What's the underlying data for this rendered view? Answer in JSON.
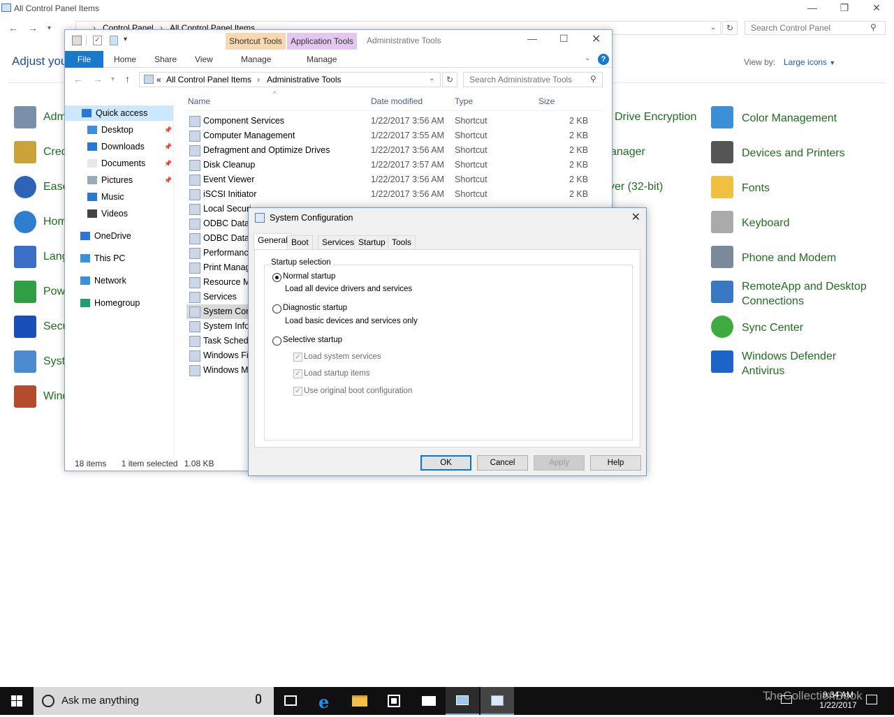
{
  "control_panel": {
    "title": "All Control Panel Items",
    "breadcrumb": [
      "Control Panel",
      "All Control Panel Items"
    ],
    "search_placeholder": "Search Control Panel",
    "heading": "Adjust you",
    "view_by_label": "View by:",
    "view_by_value": "Large icons",
    "left_items": [
      "Adm",
      "Cred",
      "Ease",
      "Hom",
      "Lang",
      "Pow",
      "Secu",
      "Syst",
      "Wind"
    ],
    "mid_items": [
      "Drive Encryption",
      "anager",
      "yer (32-bit)"
    ],
    "right_items": [
      {
        "label": "Color Management"
      },
      {
        "label": "Devices and Printers"
      },
      {
        "label": "Fonts"
      },
      {
        "label": "Keyboard"
      },
      {
        "label": "Phone and Modem"
      },
      {
        "label": "RemoteApp and Desktop",
        "label2": "Connections"
      },
      {
        "label": "Sync Center"
      },
      {
        "label": "Windows Defender",
        "label2": "Antivirus"
      }
    ]
  },
  "explorer": {
    "context_tabs": [
      "Shortcut Tools",
      "Application Tools"
    ],
    "window_title": "Administrative Tools",
    "ribbon_tabs": [
      "File",
      "Home",
      "Share",
      "View",
      "Manage",
      "Manage"
    ],
    "address": [
      "All Control Panel Items",
      "Administrative Tools"
    ],
    "address_prefix": "«",
    "search_placeholder": "Search Administrative Tools",
    "nav_items": [
      {
        "label": "Quick access",
        "pinned": false
      },
      {
        "label": "Desktop",
        "pinned": true
      },
      {
        "label": "Downloads",
        "pinned": true
      },
      {
        "label": "Documents",
        "pinned": true
      },
      {
        "label": "Pictures",
        "pinned": true
      },
      {
        "label": "Music",
        "pinned": false
      },
      {
        "label": "Videos",
        "pinned": false
      },
      {
        "label": "OneDrive",
        "pinned": false
      },
      {
        "label": "This PC",
        "pinned": false
      },
      {
        "label": "Network",
        "pinned": false
      },
      {
        "label": "Homegroup",
        "pinned": false
      }
    ],
    "columns": [
      "Name",
      "Date modified",
      "Type",
      "Size"
    ],
    "files": [
      {
        "name": "Component Services",
        "date": "1/22/2017 3:56 AM",
        "type": "Shortcut",
        "size": "2 KB"
      },
      {
        "name": "Computer Management",
        "date": "1/22/2017 3:55 AM",
        "type": "Shortcut",
        "size": "2 KB"
      },
      {
        "name": "Defragment and Optimize Drives",
        "date": "1/22/2017 3:56 AM",
        "type": "Shortcut",
        "size": "2 KB"
      },
      {
        "name": "Disk Cleanup",
        "date": "1/22/2017 3:57 AM",
        "type": "Shortcut",
        "size": "2 KB"
      },
      {
        "name": "Event Viewer",
        "date": "1/22/2017 3:56 AM",
        "type": "Shortcut",
        "size": "2 KB"
      },
      {
        "name": "iSCSI Initiator",
        "date": "1/22/2017 3:56 AM",
        "type": "Shortcut",
        "size": "2 KB"
      },
      {
        "name": "Local Securi",
        "date": "",
        "type": "",
        "size": ""
      },
      {
        "name": "ODBC Data S",
        "date": "",
        "type": "",
        "size": ""
      },
      {
        "name": "ODBC Data S",
        "date": "",
        "type": "",
        "size": ""
      },
      {
        "name": "Performance",
        "date": "",
        "type": "",
        "size": ""
      },
      {
        "name": "Print Manag",
        "date": "",
        "type": "",
        "size": ""
      },
      {
        "name": "Resource Mo",
        "date": "",
        "type": "",
        "size": ""
      },
      {
        "name": "Services",
        "date": "",
        "type": "",
        "size": ""
      },
      {
        "name": "System Conf",
        "date": "",
        "type": "",
        "size": ""
      },
      {
        "name": "System Infor",
        "date": "",
        "type": "",
        "size": ""
      },
      {
        "name": "Task Schedu",
        "date": "",
        "type": "",
        "size": ""
      },
      {
        "name": "Windows Fir",
        "date": "",
        "type": "",
        "size": ""
      },
      {
        "name": "Windows Me",
        "date": "",
        "type": "",
        "size": ""
      }
    ],
    "status": {
      "count": "18 items",
      "selected": "1 item selected",
      "size": "1.08 KB"
    }
  },
  "dialog": {
    "title": "System Configuration",
    "tabs": [
      "General",
      "Boot",
      "Services",
      "Startup",
      "Tools"
    ],
    "group_label": "Startup selection",
    "options": [
      {
        "label": "Normal startup",
        "desc": "Load all device drivers and services",
        "selected": true
      },
      {
        "label": "Diagnostic startup",
        "desc": "Load basic devices and services only",
        "selected": false
      },
      {
        "label": "Selective startup",
        "desc": "",
        "selected": false
      }
    ],
    "checks": [
      "Load system services",
      "Load startup items",
      "Use original boot configuration"
    ],
    "buttons": {
      "ok": "OK",
      "cancel": "Cancel",
      "apply": "Apply",
      "help": "Help"
    }
  },
  "taskbar": {
    "search": "Ask me anything",
    "time": "9:34 AM",
    "date": "1/22/2017",
    "watermark": "TheCollectionBook"
  }
}
